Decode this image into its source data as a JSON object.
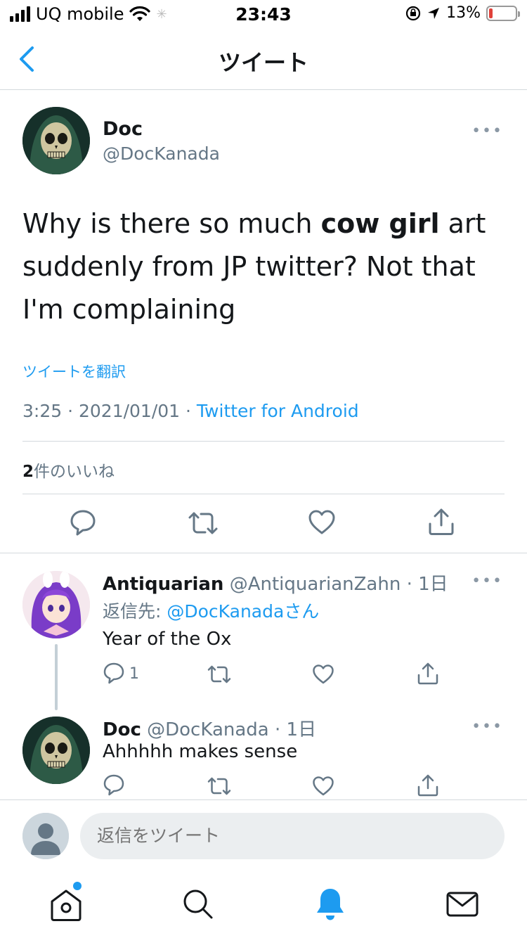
{
  "status_bar": {
    "carrier": "UQ mobile",
    "time": "23:43",
    "battery": "13%"
  },
  "header": {
    "title": "ツイート"
  },
  "main_tweet": {
    "name": "Doc",
    "handle": "@DocKanada",
    "text_before": "Why is there so much ",
    "text_bold": "cow girl",
    "text_after": " art suddenly from JP twitter? Not that I'm complaining",
    "translate_label": "ツイートを翻訳",
    "time": "3:25",
    "date": "2021/01/01",
    "source": "Twitter for Android",
    "likes_count": "2",
    "likes_label": "件のいいね"
  },
  "replies": [
    {
      "name": "Antiquarian",
      "handle": "@AntiquarianZahn",
      "age": "1日",
      "reply_to_label": "返信先: ",
      "reply_to_handle": "@DocKanada",
      "reply_to_suffix": "さん",
      "text": "Year of the Ox",
      "reply_count": "1"
    },
    {
      "name": "Doc",
      "handle": "@DocKanada",
      "age": "1日",
      "text": "Ahhhhh makes sense"
    }
  ],
  "compose": {
    "placeholder": "返信をツイート"
  },
  "colors": {
    "accent": "#1d9bf0",
    "secondary_text": "#657786",
    "border": "#d4d9dd"
  }
}
